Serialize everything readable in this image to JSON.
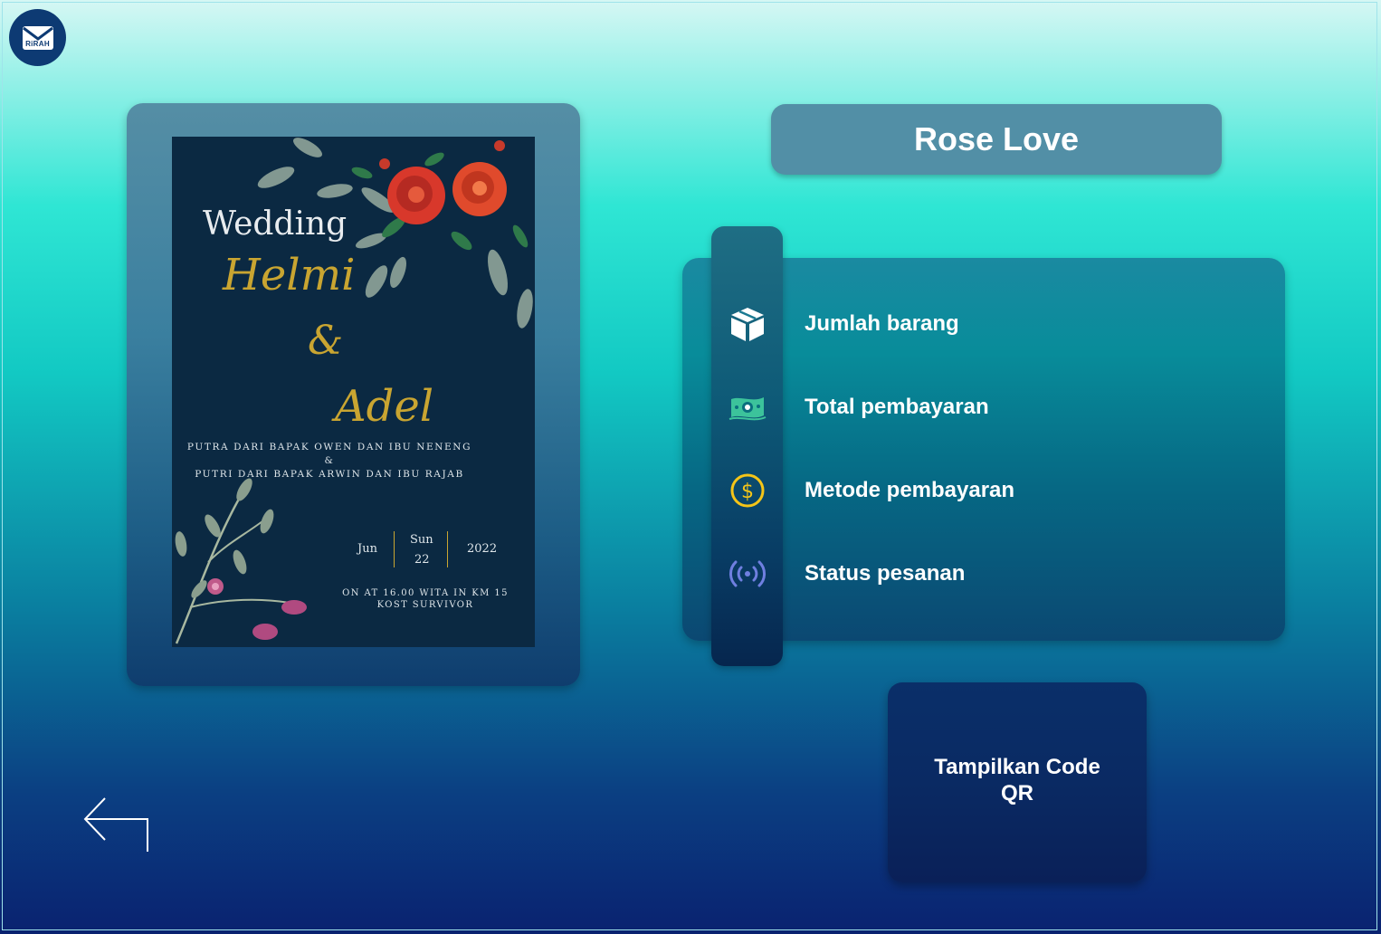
{
  "app": {
    "logo_text": "RiRAH"
  },
  "product": {
    "title": "Rose Love"
  },
  "invitation": {
    "heading": "Wedding",
    "groom": "Helmi",
    "ampersand": "&",
    "bride": "Adel",
    "parents_line1": "PUTRA DARI BAPAK OWEN DAN IBU NENENG",
    "parents_amp": "&",
    "parents_line2": "PUTRI DARI BAPAK ARWIN DAN IBU RAJAB",
    "month": "Jun",
    "day_name": "Sun",
    "day_number": "22",
    "year": "2022",
    "venue_line1": "ON AT 16.00 WITA IN KM 15",
    "venue_line2": "KOST SURVIVOR"
  },
  "details": [
    {
      "icon": "box-icon",
      "label": "Jumlah barang"
    },
    {
      "icon": "money-icon",
      "label": "Total pembayaran"
    },
    {
      "icon": "dollar-coin-icon",
      "label": "Metode pembayaran"
    },
    {
      "icon": "broadcast-icon",
      "label": "Status pesanan"
    }
  ],
  "actions": {
    "show_qr_label": "Tampilkan Code QR"
  },
  "colors": {
    "accent_gold": "#c9a531",
    "coin_yellow": "#f5c518",
    "money_green": "#3cc39b",
    "broadcast_purple": "#6f7fe0"
  }
}
